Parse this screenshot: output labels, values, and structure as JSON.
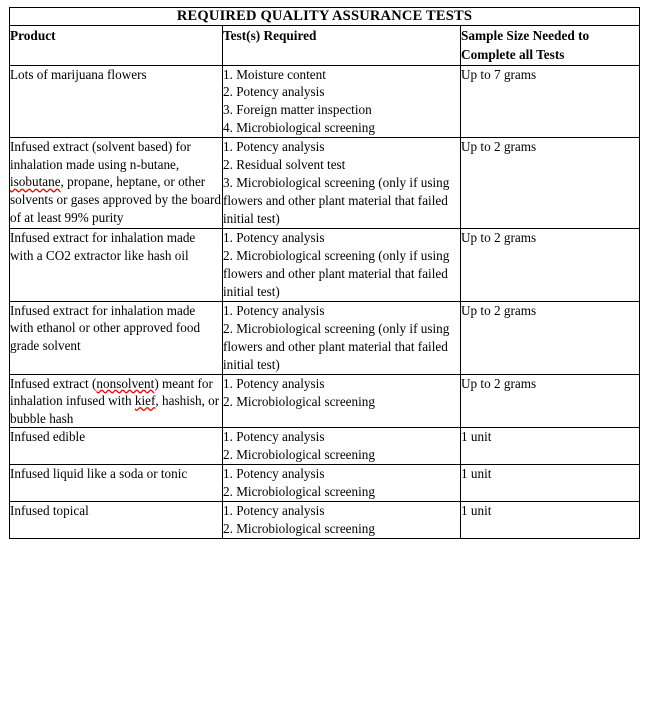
{
  "document": {
    "title": "REQUIRED QUALITY ASSURANCE TESTS"
  },
  "table": {
    "columns": [
      {
        "key": "product",
        "label": "Product"
      },
      {
        "key": "tests",
        "label": "Test(s) Required"
      },
      {
        "key": "sample_size",
        "label": "Sample Size Needed to Complete all Tests"
      }
    ],
    "column_header_lines": {
      "sample_size": [
        "Sample Size Needed to",
        "Complete all Tests"
      ]
    },
    "rows": [
      {
        "product": "Lots of marijuana flowers",
        "tests": [
          "1. Moisture content",
          "2. Potency analysis",
          "3. Foreign matter inspection",
          "4. Microbiological screening"
        ],
        "sample_size": "Up to 7 grams"
      },
      {
        "product": "Infused extract (solvent based) for inhalation made using n-butane, isobutane, propane, heptane, or other solvents or gases approved by the board of at least 99% purity",
        "product_misspelled": [
          "isobutane"
        ],
        "tests": [
          "1. Potency analysis",
          "2. Residual solvent test",
          "3. Microbiological screening (only if using flowers and other plant material that failed initial test)"
        ],
        "sample_size": "Up to 2 grams"
      },
      {
        "product": "Infused extract for inhalation made with a CO2 extractor like hash oil",
        "tests": [
          "1. Potency analysis",
          "2. Microbiological screening (only if using flowers and other plant material that failed initial test)"
        ],
        "sample_size": "Up to 2 grams"
      },
      {
        "product": "Infused extract for inhalation made with ethanol or other approved food grade solvent",
        "tests": [
          "1. Potency analysis",
          "2. Microbiological screening (only if using flowers and other plant material that failed initial test)"
        ],
        "sample_size": "Up to 2 grams"
      },
      {
        "product": "Infused extract (nonsolvent) meant for inhalation infused with kief, hashish, or bubble hash",
        "product_misspelled": [
          "nonsolvent",
          "kief"
        ],
        "tests": [
          "1. Potency analysis",
          "2. Microbiological screening"
        ],
        "sample_size": "Up to 2 grams"
      },
      {
        "product": "Infused edible",
        "tests": [
          "1. Potency analysis",
          "2. Microbiological screening"
        ],
        "sample_size": "1 unit"
      },
      {
        "product": "Infused liquid like a soda or tonic",
        "tests": [
          "1. Potency analysis",
          "2. Microbiological screening"
        ],
        "sample_size": "1 unit"
      },
      {
        "product": "Infused topical",
        "tests": [
          "1. Potency analysis",
          "2. Microbiological screening"
        ],
        "sample_size": "1 unit"
      }
    ]
  },
  "style": {
    "title_background": "#d9d9d9",
    "border_color": "#000000",
    "text_color": "#000000",
    "page_background": "#ffffff",
    "spellcheck_underline_color": "#ff0000"
  }
}
